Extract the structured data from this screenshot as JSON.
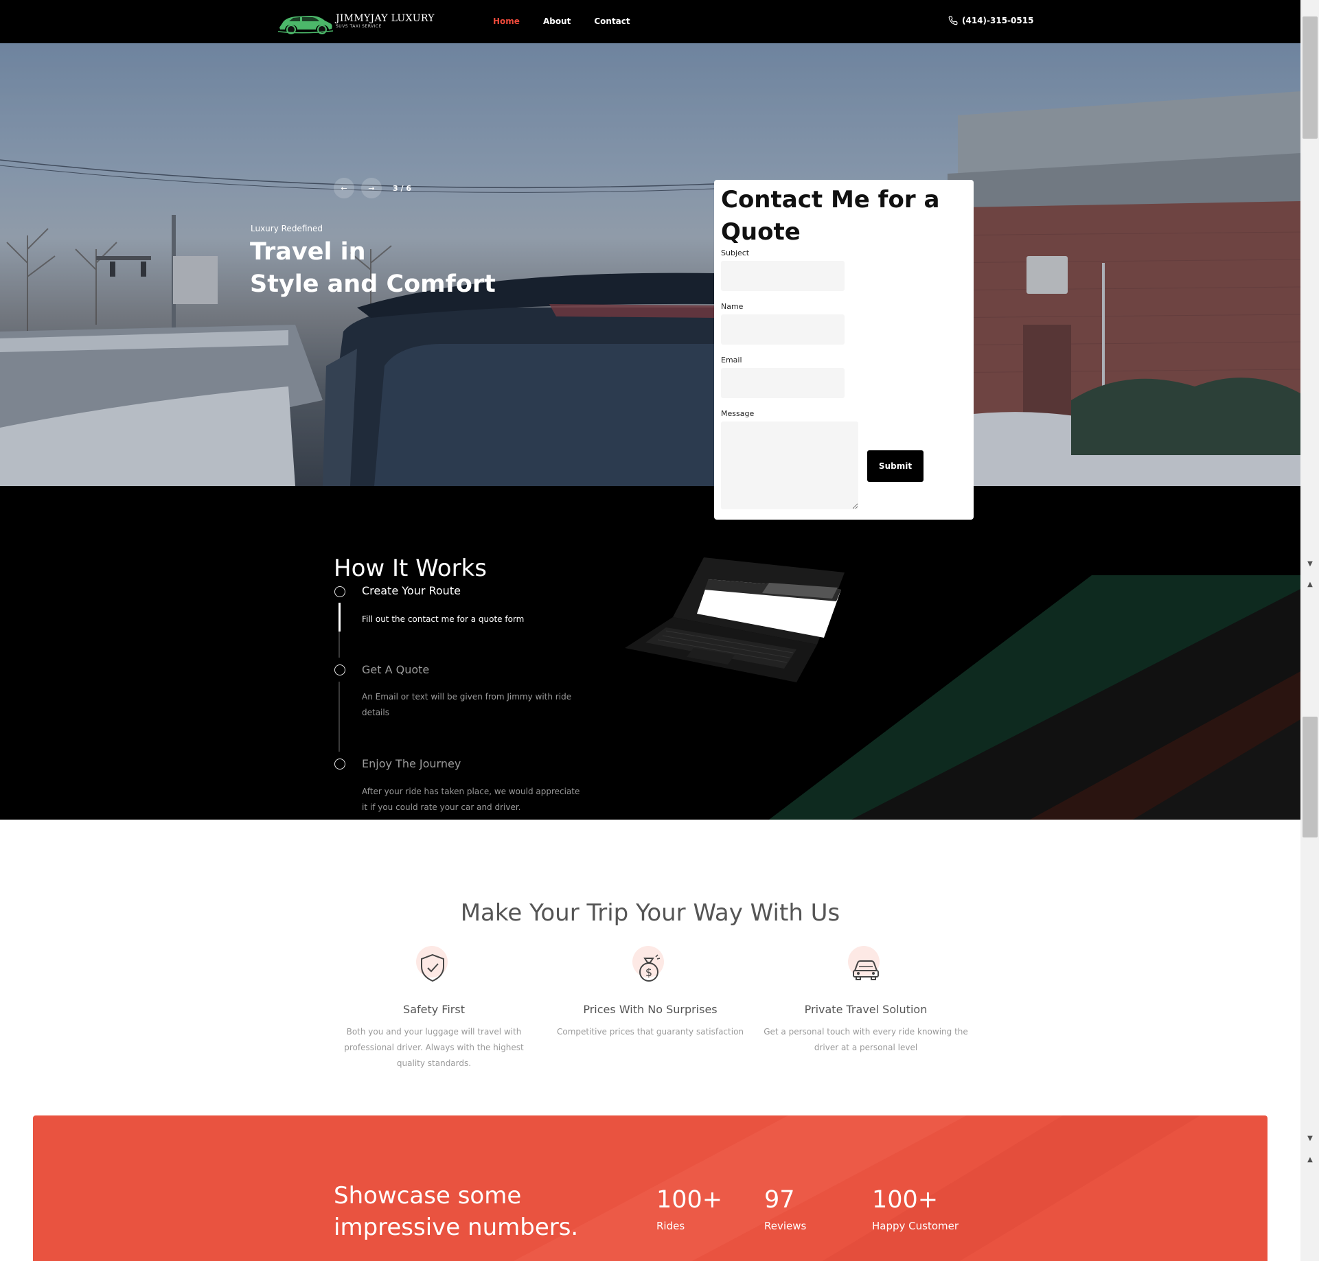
{
  "header": {
    "logo_title": "JIMMYJAY LUXURY",
    "logo_subtitle": "SUVS TAXI SERVICE",
    "nav": [
      {
        "label": "Home",
        "active": true
      },
      {
        "label": "About",
        "active": false
      },
      {
        "label": "Contact",
        "active": false
      }
    ],
    "phone": "(414)-315-0515"
  },
  "hero": {
    "slide_counter": "3 / 6",
    "prev_icon": "arrow-left-icon",
    "next_icon": "arrow-right-icon",
    "eyebrow": "Luxury Redefined",
    "title_line1": "Travel in",
    "title_line2": "Style and Comfort"
  },
  "contact_form": {
    "title": "Contact Me for a Quote",
    "subject_label": "Subject",
    "name_label": "Name",
    "email_label": "Email",
    "message_label": "Message",
    "subject_value": "",
    "name_value": "",
    "email_value": "",
    "message_value": "",
    "submit_label": "Submit"
  },
  "how_it_works": {
    "title": "How It Works",
    "steps": [
      {
        "title": "Create Your Route",
        "desc": "Fill out the contact me for a quote form",
        "active": true
      },
      {
        "title": "Get A Quote",
        "desc": "An Email or text will be given from Jimmy with ride details",
        "active": false
      },
      {
        "title": "Enjoy The Journey",
        "desc": "After your ride has taken place, we would appreciate it if you could rate your car and driver.",
        "active": false
      }
    ]
  },
  "features": {
    "title": "Make Your Trip Your Way With Us",
    "items": [
      {
        "icon": "shield-check-icon",
        "title": "Safety First",
        "desc": "Both you and your luggage will travel with professional driver. Always with the highest quality standards."
      },
      {
        "icon": "money-bag-icon",
        "title": "Prices With No Surprises",
        "desc": "Competitive prices that guaranty satisfaction"
      },
      {
        "icon": "car-icon",
        "title": "Private Travel Solution",
        "desc": "Get a personal touch with every ride knowing the driver at a personal level"
      }
    ]
  },
  "stats": {
    "heading_line1": "Showcase some",
    "heading_line2": "impressive numbers.",
    "items": [
      {
        "value": "100+",
        "label": "Rides"
      },
      {
        "value": "97",
        "label": "Reviews"
      },
      {
        "value": "100+",
        "label": "Happy Customer"
      }
    ]
  },
  "colors": {
    "accent": "#e95340",
    "nav_active": "#ef4a3b",
    "header_bg": "#000000",
    "logo_green": "#4cb86a"
  }
}
